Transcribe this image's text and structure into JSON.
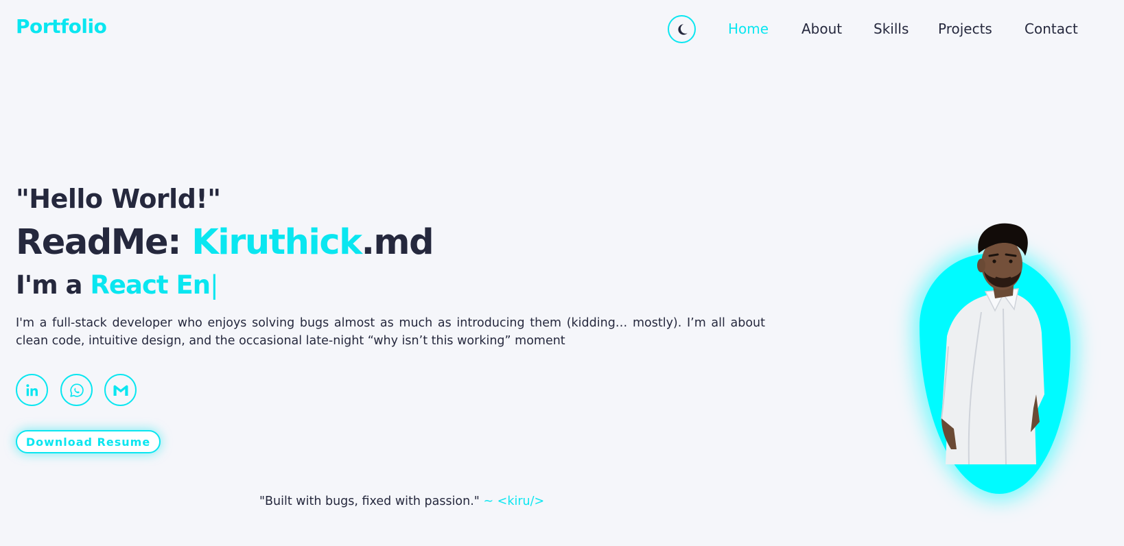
{
  "header": {
    "logo": "Portfolio",
    "theme_toggle_icon": "moon-icon",
    "nav": [
      {
        "label": "Home",
        "active": true
      },
      {
        "label": "About",
        "active": false
      },
      {
        "label": "Skills",
        "active": false
      },
      {
        "label": "Projects",
        "active": false
      },
      {
        "label": "Contact",
        "active": false
      }
    ]
  },
  "hero": {
    "greeting": "\"Hello World!\"",
    "title_prefix": "ReadMe: ",
    "title_name": "Kiruthick",
    "title_suffix": ".md",
    "role_prefix": "I'm a ",
    "role_typed": "React En",
    "role_cursor": "|",
    "intro": "I'm a full-stack developer who enjoys solving bugs almost as much as introducing them (kidding… mostly). I’m all about clean code, intuitive design, and the occasional late-night “why isn’t this working” moment",
    "social": [
      {
        "icon": "linkedin-icon"
      },
      {
        "icon": "whatsapp-icon"
      },
      {
        "icon": "gmail-icon"
      }
    ],
    "resume_button": "Download Resume"
  },
  "footer": {
    "quote": "\"Built with bugs, fixed with passion.\"",
    "signature": "~ <kiru/>"
  },
  "colors": {
    "accent": "#0ae6f0",
    "text": "#25283d",
    "background": "#f5f6fa",
    "blob": "#00fbff"
  }
}
